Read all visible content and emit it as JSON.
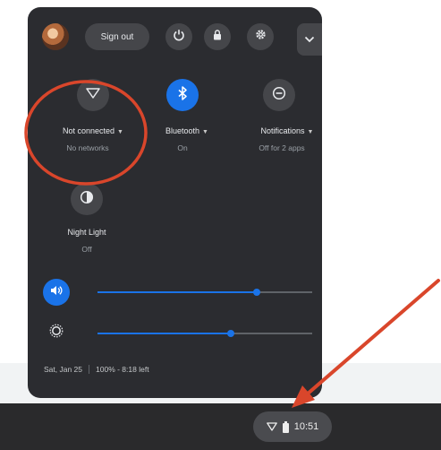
{
  "header": {
    "sign_out_label": "Sign out",
    "icons": [
      "power-icon",
      "lock-icon",
      "gear-icon",
      "chevron-down-icon"
    ]
  },
  "tiles": [
    {
      "name": "network",
      "icon": "wifi-icon",
      "label": "Not connected",
      "sublabel": "No networks",
      "active": false
    },
    {
      "name": "bluetooth",
      "icon": "bluetooth-icon",
      "label": "Bluetooth",
      "sublabel": "On",
      "active": true
    },
    {
      "name": "notifications",
      "icon": "do-not-disturb-icon",
      "label": "Notifications",
      "sublabel": "Off for 2 apps",
      "active": false
    },
    {
      "name": "night-light",
      "icon": "night-light-icon",
      "label": "Night Light",
      "sublabel": "Off",
      "active": false
    }
  ],
  "sliders": {
    "volume": {
      "icon": "volume-icon",
      "level": 0.74
    },
    "brightness": {
      "icon": "brightness-icon",
      "level": 0.62
    }
  },
  "footer": {
    "date": "Sat, Jan 25",
    "battery": "100% - 8:18 left"
  },
  "shelf": {
    "time": "10:51",
    "icons": [
      "wifi-icon",
      "battery-icon"
    ]
  },
  "colors": {
    "panel_bg": "#2b2c30",
    "accent": "#1a73e8",
    "annotation": "#d9462b"
  }
}
